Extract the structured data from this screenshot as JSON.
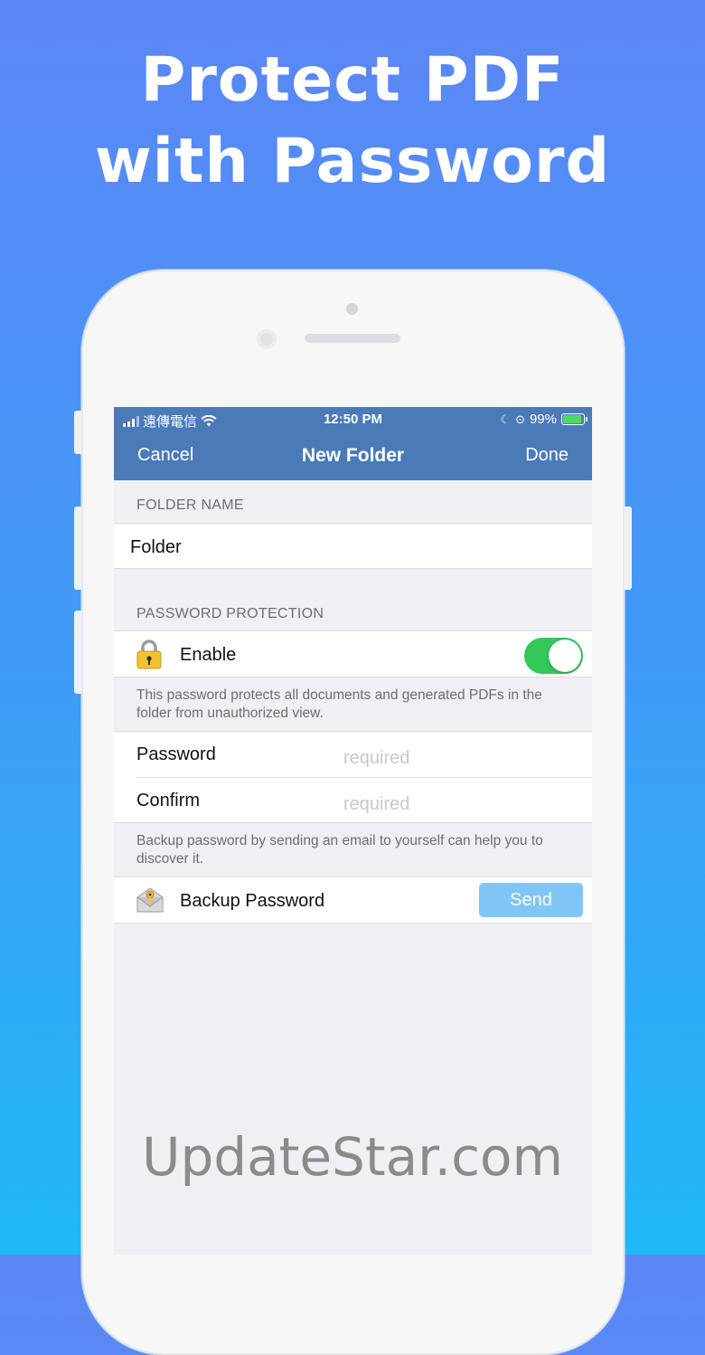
{
  "headline": {
    "line1": "Protect PDF",
    "line2": "with Password"
  },
  "status_bar": {
    "carrier": "遠傳電信",
    "time": "12:50 PM",
    "battery": "99%"
  },
  "nav": {
    "cancel": "Cancel",
    "title": "New Folder",
    "done": "Done"
  },
  "folder_section": {
    "header": "FOLDER NAME",
    "value": "Folder"
  },
  "password_section": {
    "header": "PASSWORD PROTECTION",
    "enable_label": "Enable",
    "enabled": true,
    "note": "This password protects all documents and generated PDFs in the folder from unauthorized view.",
    "password_label": "Password",
    "password_placeholder": "required",
    "confirm_label": "Confirm",
    "confirm_placeholder": "required"
  },
  "backup_section": {
    "note": "Backup password by sending an email to yourself can help you to discover it.",
    "label": "Backup Password",
    "send_label": "Send"
  },
  "colors": {
    "nav": "#4a7bb8",
    "toggle_on": "#34c759",
    "send_button": "#7fc6f6"
  },
  "icons": {
    "lock": "padlock-icon",
    "envelope": "key-envelope-icon"
  },
  "watermark": "UpdateStar.com"
}
